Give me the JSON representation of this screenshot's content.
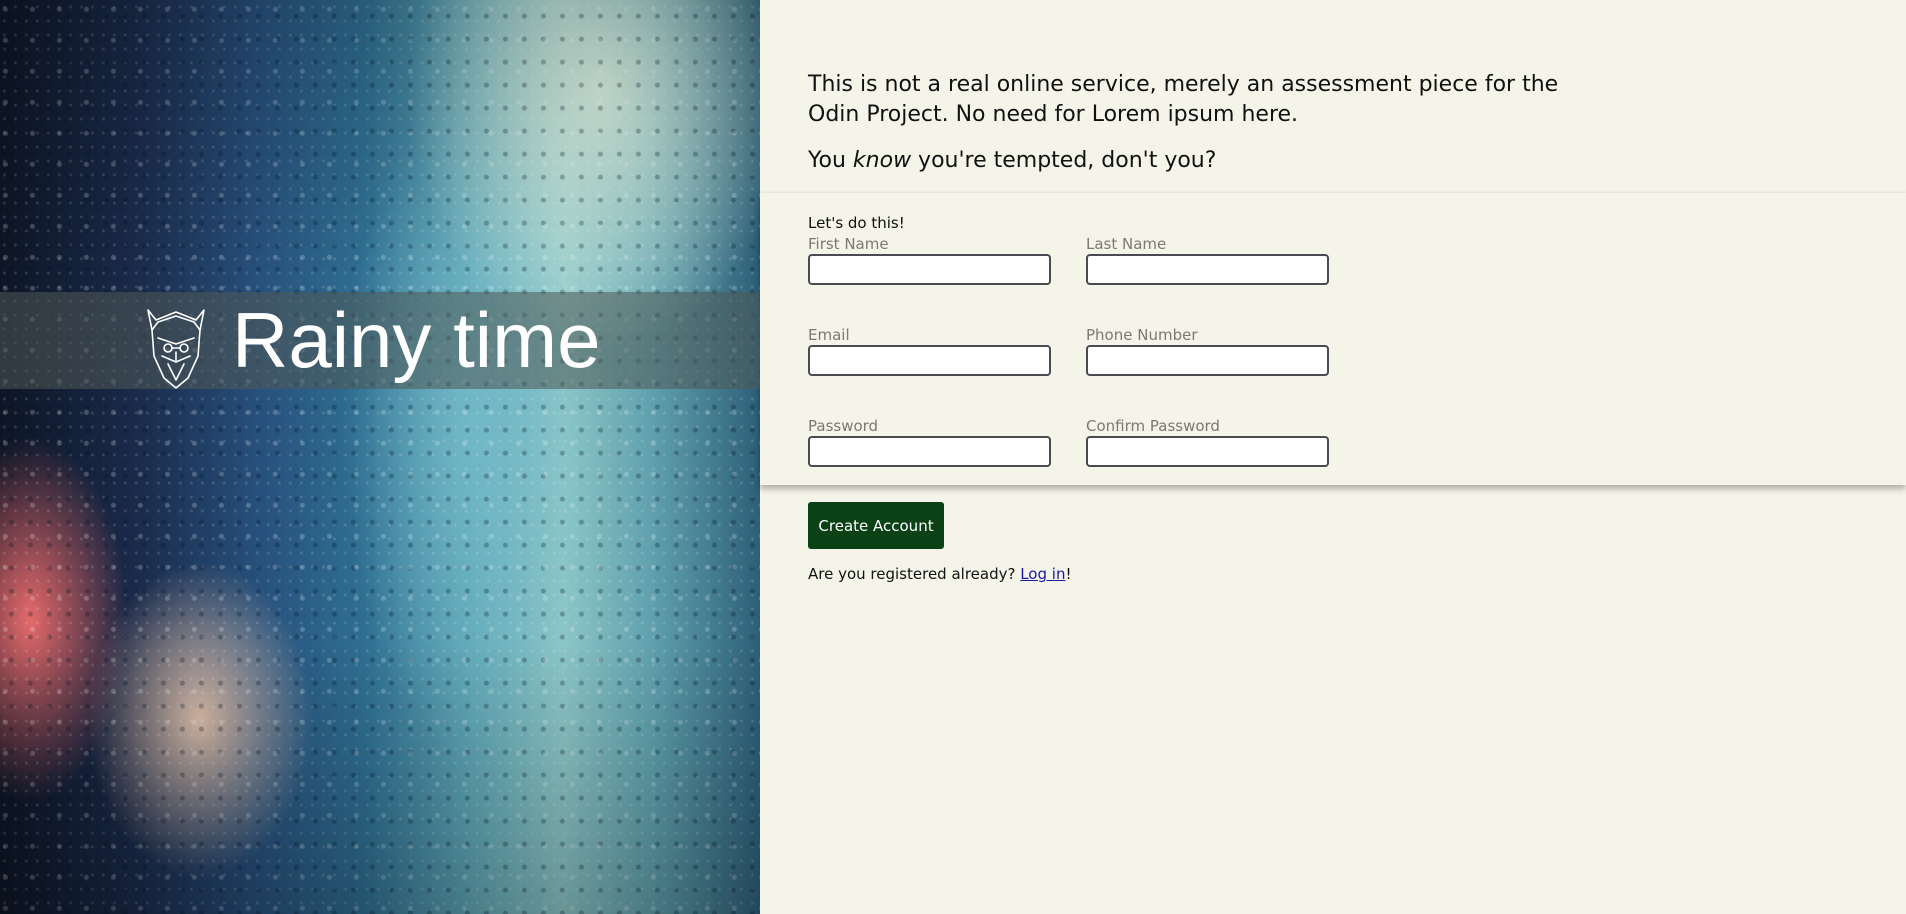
{
  "brand": {
    "title": "Rainy time",
    "logo_icon": "viking-helmet-face-icon"
  },
  "intro": {
    "line1": "This is not a real online service, merely an assessment piece for the Odin Project. No need for Lorem ipsum here.",
    "tempt_prefix": "You ",
    "tempt_em": "know",
    "tempt_suffix": " you're tempted, don't you?"
  },
  "form": {
    "heading": "Let's do this!",
    "first_name_label": "First Name",
    "last_name_label": "Last Name",
    "email_label": "Email",
    "phone_label": "Phone Number",
    "password_label": "Password",
    "confirm_password_label": "Confirm Password",
    "first_name_value": "",
    "last_name_value": "",
    "email_value": "",
    "phone_value": "",
    "password_value": "",
    "confirm_password_value": "",
    "submit_label": "Create Account"
  },
  "login": {
    "prompt": "Are you registered already? ",
    "link_label": "Log in",
    "suffix": "!"
  },
  "colors": {
    "page_bg": "#f5f4e8",
    "button_bg": "#0a4216",
    "link": "#1a1aa6",
    "label": "#7a7a72"
  }
}
